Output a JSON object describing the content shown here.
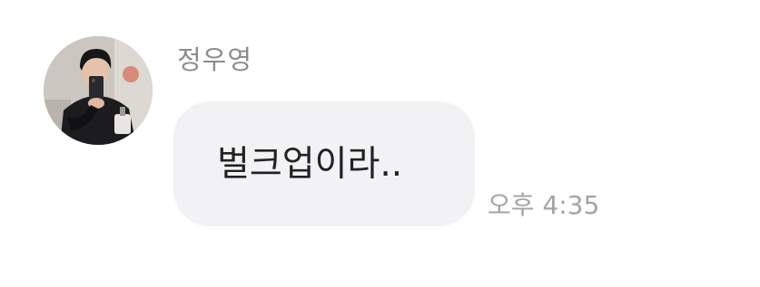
{
  "message": {
    "sender": "정우영",
    "text": "벌크업이라..",
    "time": "오후 4:35"
  },
  "avatar": {
    "icon": "profile-photo-avatar"
  },
  "colors": {
    "bubble": "#f2f2f5",
    "sender": "#8c8c8c",
    "time": "#a3a3a3",
    "text": "#222222"
  }
}
